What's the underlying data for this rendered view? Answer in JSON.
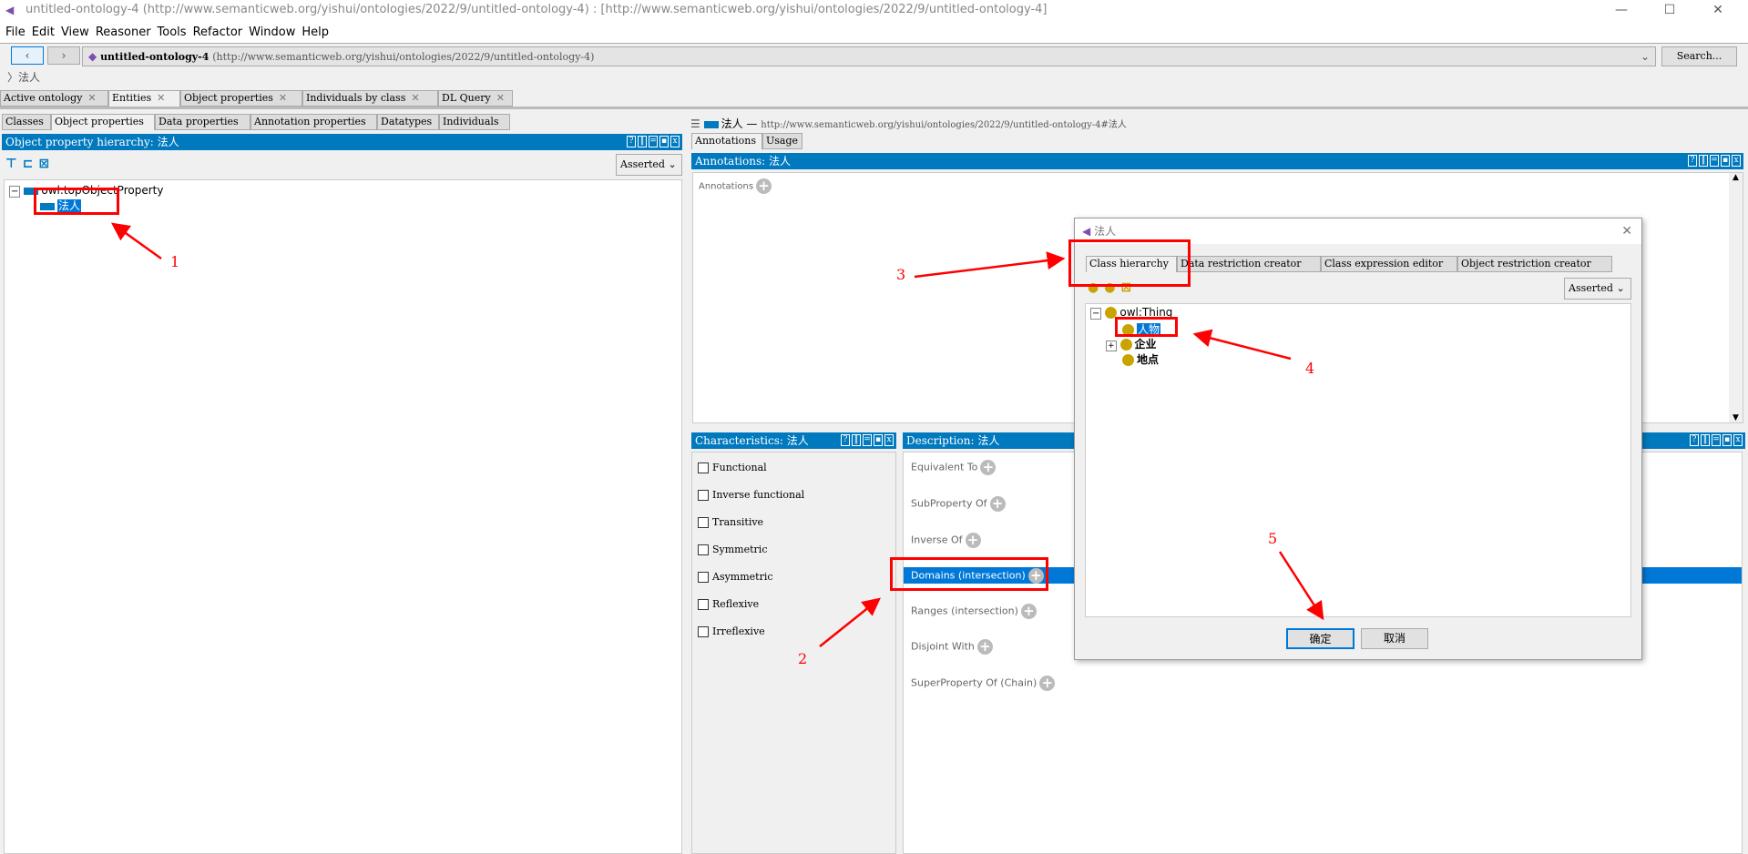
{
  "window": {
    "title": "untitled-ontology-4 (http://www.semanticweb.org/yishui/ontologies/2022/9/untitled-ontology-4)  : [http://www.semanticweb.org/yishui/ontologies/2022/9/untitled-ontology-4]",
    "minimize": "—",
    "maximize": "☐",
    "close": "✕"
  },
  "menu": [
    "File",
    "Edit",
    "View",
    "Reasoner",
    "Tools",
    "Refactor",
    "Window",
    "Help"
  ],
  "nav": {
    "back": "‹",
    "forward": "›",
    "ontology_name": "untitled-ontology-4",
    "ontology_iri": "(http://www.semanticweb.org/yishui/ontologies/2022/9/untitled-ontology-4)",
    "search_label": "Search...",
    "breadcrumb": "〉法人"
  },
  "main_tabs": [
    {
      "label": "Active ontology"
    },
    {
      "label": "Entities"
    },
    {
      "label": "Object properties"
    },
    {
      "label": "Individuals by class"
    },
    {
      "label": "DL Query"
    }
  ],
  "entity_tabs": [
    "Classes",
    "Object properties",
    "Data properties",
    "Annotation properties",
    "Datatypes",
    "Individuals"
  ],
  "left": {
    "header": "Object property hierarchy: 法人",
    "view_mode": "Asserted",
    "tree": {
      "root": "owl:topObjectProperty",
      "child": "法人"
    }
  },
  "right": {
    "entity": "法人",
    "iri": "http://www.semanticweb.org/yishui/ontologies/2022/9/untitled-ontology-4#法人",
    "tabs": [
      "Annotations",
      "Usage"
    ],
    "annotations_header": "Annotations: 法人",
    "annotations_label": "Annotations",
    "characteristics_header": "Characteristics: 法人",
    "characteristics": [
      "Functional",
      "Inverse functional",
      "Transitive",
      "Symmetric",
      "Asymmetric",
      "Reflexive",
      "Irreflexive"
    ],
    "description_header": "Description: 法人",
    "description": [
      "Equivalent To",
      "SubProperty Of",
      "Inverse Of",
      "Domains (intersection)",
      "Ranges (intersection)",
      "Disjoint With",
      "SuperProperty Of (Chain)"
    ]
  },
  "dialog": {
    "title": "法人",
    "tabs": [
      "Class hierarchy",
      "Data restriction creator",
      "Class expression editor",
      "Object restriction creator"
    ],
    "view_mode": "Asserted",
    "tree": {
      "root": "owl:Thing",
      "children": [
        "人物",
        "企业",
        "地点"
      ]
    },
    "ok": "确定",
    "cancel": "取消"
  },
  "annotations_overlay": [
    "1",
    "2",
    "3",
    "4",
    "5"
  ],
  "colors": {
    "accent": "#0079be",
    "selection": "#0078d7",
    "annotation_red": "#ff0000",
    "class_icon": "#c9a400"
  }
}
